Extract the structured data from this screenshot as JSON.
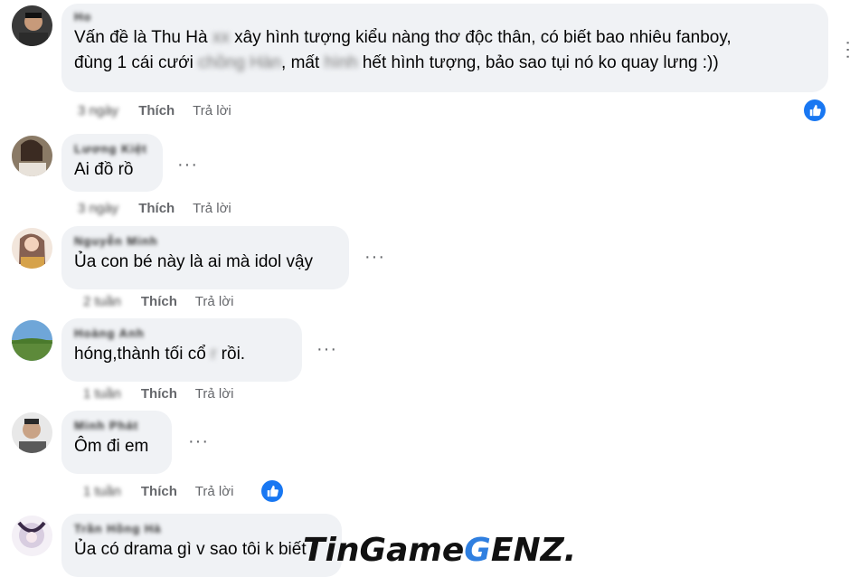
{
  "comments": [
    {
      "name": "Ho",
      "text_parts": [
        "Vấn đề là Thu Hà ",
        "xx",
        " xây hình tượng kiểu nàng thơ độc thân, có biết bao nhiêu fanboy,"
      ],
      "line2_parts": [
        "đùng 1 cái cưới ",
        "chồng Hàn",
        ", mất ",
        "hình",
        " hết hình tượng, bảo sao tụi nó ko quay lưng :))"
      ],
      "time": "3 ngày",
      "like": "Thích",
      "reply": "Trả lời"
    },
    {
      "name": "Lương Kiệt",
      "text": "Ai đồ rồ",
      "time": "3 ngày",
      "like": "Thích",
      "reply": "Trả lời"
    },
    {
      "name": "Nguyễn Minh",
      "text": "Ủa con bé này là ai mà idol vậy",
      "time": "2 tuần",
      "like": "Thích",
      "reply": "Trả lời"
    },
    {
      "name": "Hoàng Anh",
      "text_parts": [
        "hóng,thành tối cổ ",
        "r",
        " rồi."
      ],
      "time": "1 tuần",
      "like": "Thích",
      "reply": "Trả lời"
    },
    {
      "name": "Minh Phát",
      "text": "Ôm đi em",
      "time": "1 tuần",
      "like": "Thích",
      "reply": "Trả lời"
    },
    {
      "name": "Trần Hồng Hà",
      "text": "Ủa có drama gì v sao tôi k biết",
      "time": "",
      "like": "",
      "reply": ""
    }
  ],
  "more_dots": "···",
  "watermark": {
    "part1": "TinGame",
    "part2": "G",
    "part3": "ENZ."
  },
  "colors": {
    "bubble": "#f0f2f5",
    "meta": "#65676b",
    "like_blue": "#1877f2"
  },
  "icons": [
    "thumbs-up-icon",
    "more-icon"
  ]
}
